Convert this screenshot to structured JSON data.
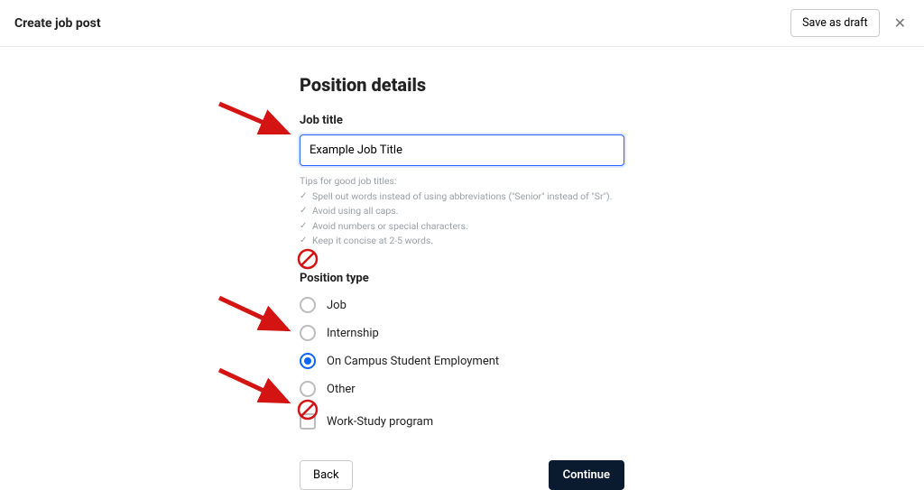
{
  "header": {
    "title": "Create job post",
    "save_draft": "Save as draft"
  },
  "page": {
    "heading": "Position details",
    "job_title_label": "Job title",
    "job_title_value": "Example Job Title",
    "tips_heading": "Tips for good job titles:",
    "tips": [
      "Spell out words instead of using abbreviations (\"Senior\" instead of \"Sr\").",
      "Avoid using all caps.",
      "Avoid numbers or special characters.",
      "Keep it concise at 2-5 words."
    ],
    "position_type_label": "Position type",
    "position_types": [
      {
        "label": "Job",
        "selected": false
      },
      {
        "label": "Internship",
        "selected": false
      },
      {
        "label": "On Campus Student Employment",
        "selected": true
      },
      {
        "label": "Other",
        "selected": false
      }
    ],
    "work_study_label": "Work-Study program"
  },
  "footer": {
    "back": "Back",
    "continue": "Continue"
  }
}
